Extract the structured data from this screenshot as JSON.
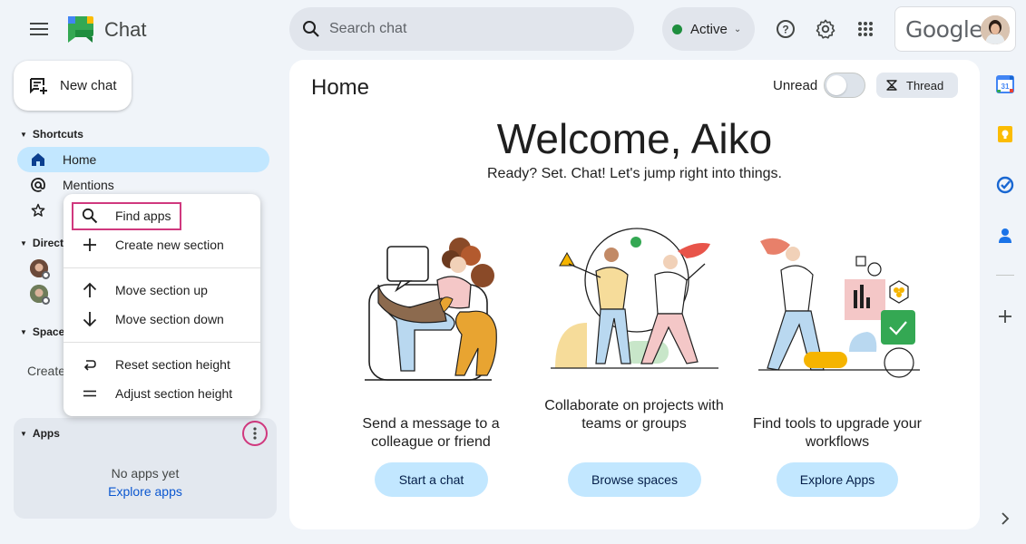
{
  "app": {
    "name": "Chat"
  },
  "search": {
    "placeholder": "Search chat"
  },
  "status": {
    "label": "Active",
    "color": "#1e8e3e"
  },
  "account": {
    "brand": "Google"
  },
  "sidebar": {
    "new_chat_label": "New chat",
    "shortcuts": {
      "title": "Shortcuts",
      "items": [
        {
          "label": "Home"
        },
        {
          "label": "Mentions"
        }
      ]
    },
    "direct_messages": {
      "title": "Direct messages"
    },
    "spaces": {
      "title": "Spaces",
      "create_label": "Create a space"
    },
    "apps": {
      "title": "Apps",
      "empty_text": "No apps yet",
      "explore_link": "Explore apps"
    }
  },
  "context_menu": {
    "items": [
      {
        "label": "Find apps",
        "icon": "search-icon"
      },
      {
        "label": "Create new section",
        "icon": "plus-icon"
      },
      {
        "label": "Move section up",
        "icon": "arrow-up-icon"
      },
      {
        "label": "Move section down",
        "icon": "arrow-down-icon"
      },
      {
        "label": "Reset section height",
        "icon": "reset-icon"
      },
      {
        "label": "Adjust section height",
        "icon": "drag-handle-icon"
      }
    ]
  },
  "main": {
    "title": "Home",
    "unread_label": "Unread",
    "thread_label": "Thread",
    "welcome": "Welcome, Aiko",
    "subtitle": "Ready? Set. Chat! Let's jump right into things.",
    "cards": [
      {
        "caption": "Send a message to a colleague or friend",
        "button": "Start a chat"
      },
      {
        "caption": "Collaborate on projects with teams or groups",
        "button": "Browse spaces"
      },
      {
        "caption": "Find tools to upgrade your workflows",
        "button": "Explore Apps"
      }
    ]
  },
  "right_rail": {
    "calendar_date": "31"
  },
  "colors": {
    "accent": "#c2e7ff",
    "highlight": "#d0387e",
    "link": "#0b57d0"
  }
}
